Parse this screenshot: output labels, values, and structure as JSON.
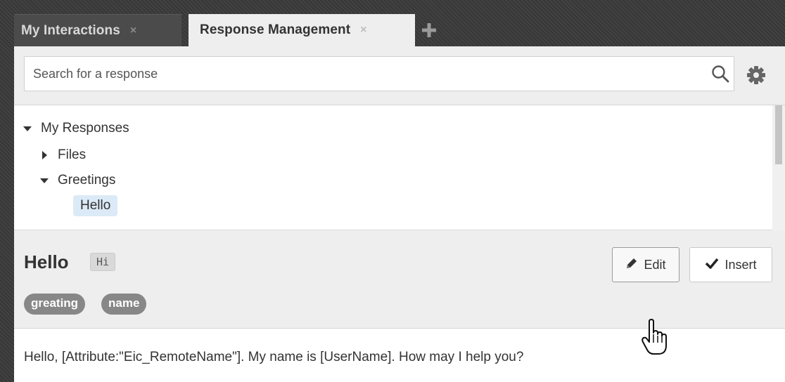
{
  "tabs": [
    {
      "label": "My Interactions",
      "close": "×"
    },
    {
      "label": "Response Management",
      "close": "×"
    }
  ],
  "add_tab_icon": "plus-icon",
  "search": {
    "placeholder": "Search for a response",
    "value": ""
  },
  "tree": {
    "root": "My Responses",
    "items": [
      {
        "label": "Files",
        "state": "collapsed"
      },
      {
        "label": "Greetings",
        "state": "expanded"
      },
      {
        "label": "Hello",
        "state": "selected"
      }
    ]
  },
  "response": {
    "title": "Hello",
    "shortcut": "Hi",
    "tags": [
      "greating",
      "name"
    ],
    "edit_label": "Edit",
    "insert_label": "Insert",
    "text": "Hello, [Attribute:\"Eic_RemoteName\"]. My name is [UserName]. How may I help you?"
  },
  "colors": {
    "frame": "#3a3a3a",
    "panel": "#eeeeee",
    "selection": "#dbeaf6",
    "tag": "#878787"
  }
}
